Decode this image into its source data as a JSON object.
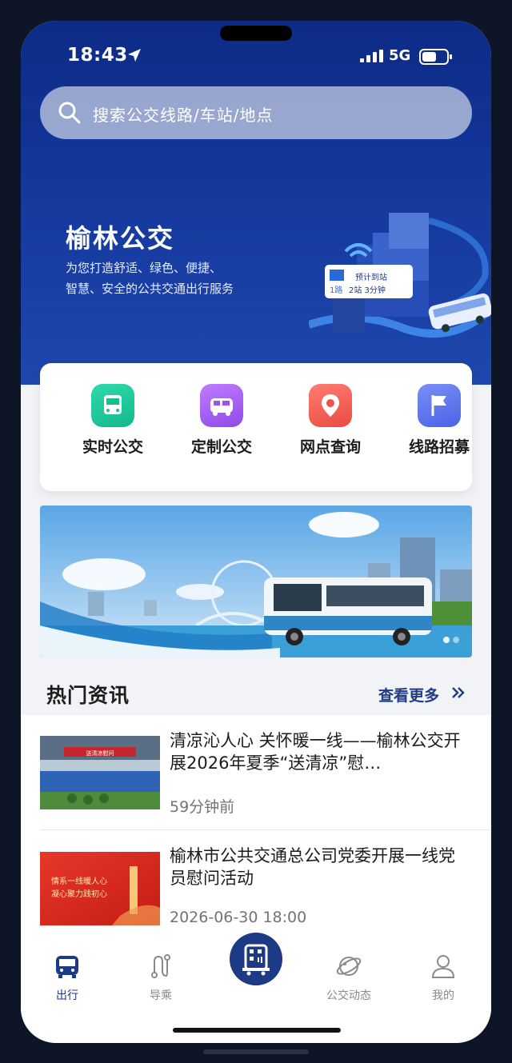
{
  "status_bar": {
    "time": "18:43",
    "network": "5G"
  },
  "search": {
    "placeholder": "搜索公交线路/车站/地点"
  },
  "brand": {
    "title": "榆林公交",
    "subtitle_line1": "为您打造舒适、绿色、便捷、",
    "subtitle_line2": "智慧、安全的公共交通出行服务",
    "illustration_sign_route": "1路",
    "illustration_sign_info": "预计到站",
    "illustration_sign_detail": "2站 3分钟"
  },
  "quick_actions": [
    {
      "label": "实时公交",
      "icon": "bus-icon",
      "color": "#19c79a"
    },
    {
      "label": "定制公交",
      "icon": "van-icon",
      "color": "#a25ff0"
    },
    {
      "label": "网点查询",
      "icon": "location-search-icon",
      "color": "#f35d52"
    },
    {
      "label": "线路招募",
      "icon": "flag-icon",
      "color": "#5b74f0"
    }
  ],
  "news_section": {
    "title": "热门资讯",
    "more_label": "查看更多"
  },
  "news": [
    {
      "title": "清凉沁人心 关怀暖一线——榆林公交开展2026年夏季“送清凉”慰…",
      "time": "59分钟前",
      "thumb_text": "送清凉慰问"
    },
    {
      "title": "榆林市公共交通总公司党委开展一线党员慰问活动",
      "time": "2026-06-30 18:00",
      "thumb_line1": "情系一线暖人心",
      "thumb_line2": "凝心聚力践初心"
    }
  ],
  "tabbar": [
    {
      "label": "出行",
      "active": true
    },
    {
      "label": "导乘",
      "active": false
    },
    {
      "label": "公交动态",
      "active": false
    },
    {
      "label": "我的",
      "active": false
    }
  ],
  "colors": {
    "primary": "#1d3a86",
    "hero": "#13369a"
  }
}
